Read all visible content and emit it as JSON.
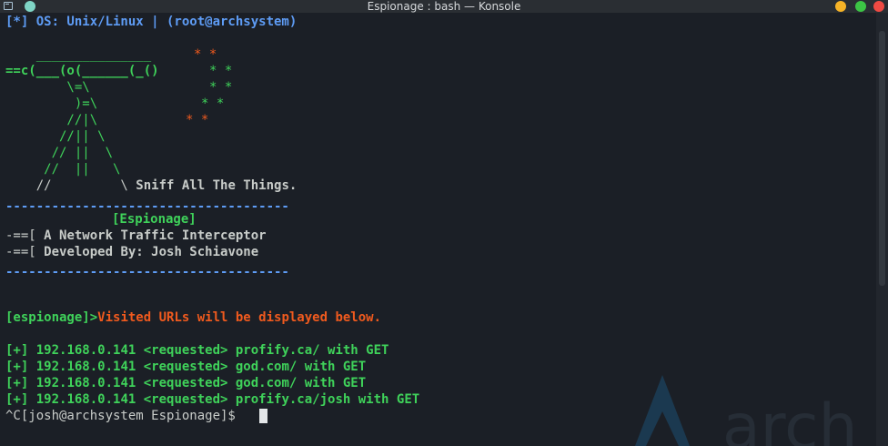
{
  "window": {
    "title": "Espionage : bash — Konsole"
  },
  "header": {
    "os_line": "[*] OS: Unix/Linux | (root@archsystem)"
  },
  "banner": {
    "art": {
      "l1": "    _______________",
      "l2": "==c(___(o(______(_()",
      "l3": "        \\=\\",
      "l4": "         )=\\",
      "l5": "        //|\\",
      "l6": "       //|| \\",
      "l7": "      // ||  \\",
      "l8": "     //  ||   \\",
      "l9": "    //         \\"
    },
    "stars": {
      "s1": "* *",
      "s2": "* *",
      "s3": "* *",
      "s4": "* *",
      "s5": "* *"
    },
    "tagline": "Sniff All The Things.",
    "divider": "-------------------------------------",
    "tool_name": "[Espionage]",
    "desc_prefix": "-==[",
    "desc": "A Network Traffic Interceptor",
    "dev_prefix": "-==[",
    "dev": "Developed By: Josh Schiavone"
  },
  "status": {
    "prompt": "[espionage]>",
    "message": "Visited URLs will be displayed below."
  },
  "log": [
    {
      "tag": "[+]",
      "text": "192.168.0.141 <requested> profify.ca/ with GET"
    },
    {
      "tag": "[+]",
      "text": "192.168.0.141 <requested> god.com/ with GET"
    },
    {
      "tag": "[+]",
      "text": "192.168.0.141 <requested> god.com/ with GET"
    },
    {
      "tag": "[+]",
      "text": "192.168.0.141 <requested> profify.ca/josh with GET"
    }
  ],
  "shell": {
    "prompt": "^C[josh@archsystem Espionage]$ "
  },
  "watermark": {
    "text": "arch"
  },
  "colors": {
    "green": "#3fd25a",
    "orange": "#f05a1e",
    "blue": "#5e9cf5",
    "background": "#1b1f26"
  }
}
